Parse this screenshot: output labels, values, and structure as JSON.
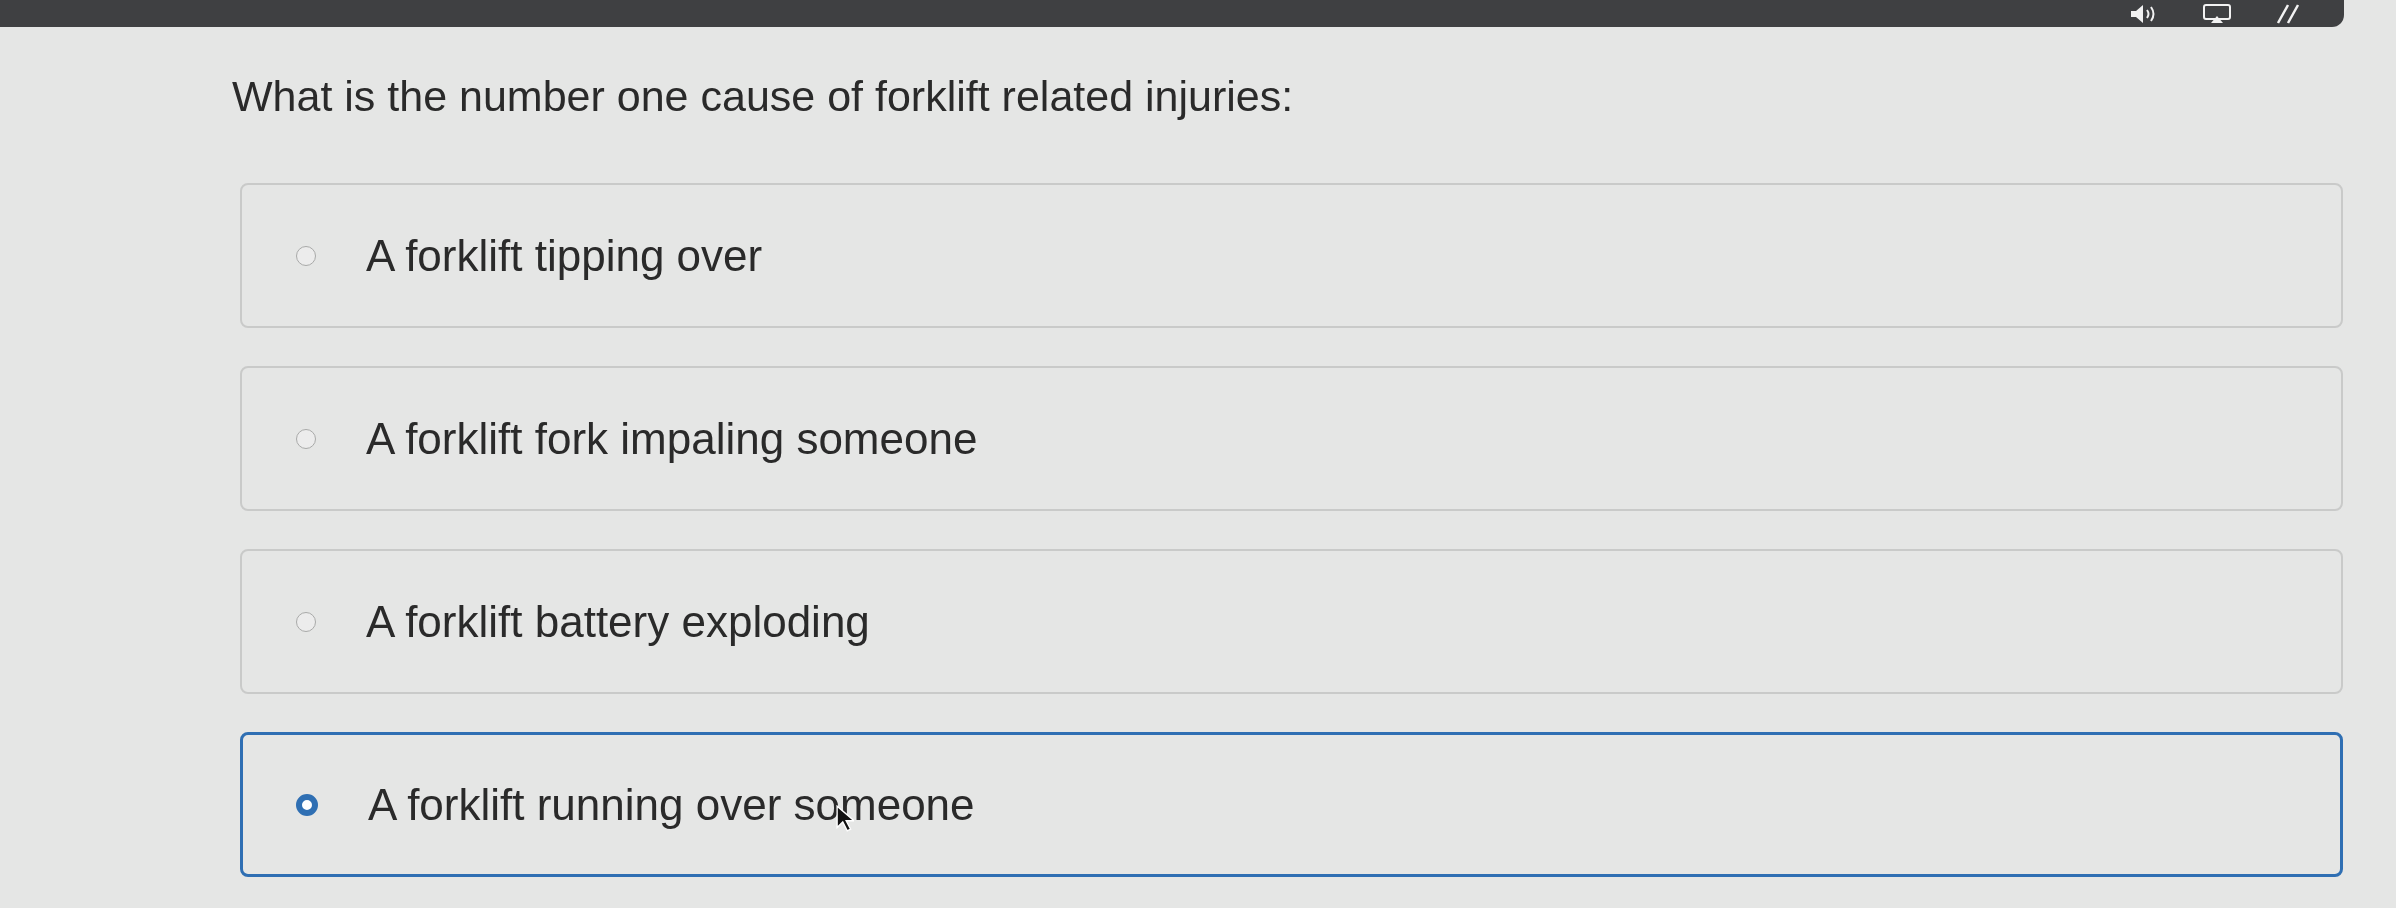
{
  "question": {
    "text": "What is the number one cause of forklift related injuries:"
  },
  "options": [
    {
      "label": "A forklift tipping over",
      "selected": false
    },
    {
      "label": "A forklift fork impaling someone",
      "selected": false
    },
    {
      "label": "A forklift battery exploding",
      "selected": false
    },
    {
      "label": "A forklift running over someone",
      "selected": true
    }
  ]
}
